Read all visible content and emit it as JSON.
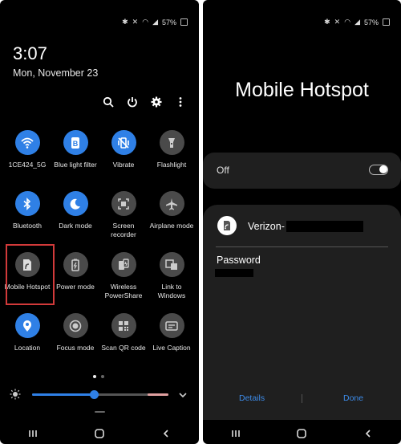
{
  "left": {
    "status": {
      "battery": "57%"
    },
    "clock": "3:07",
    "date": "Mon, November 23",
    "top_icons": [
      "search-icon",
      "power-icon",
      "settings-icon",
      "more-icon"
    ],
    "tiles": [
      [
        {
          "label": "1CE424_5G",
          "icon": "wifi-icon",
          "on": true
        },
        {
          "label": "Blue light filter",
          "icon": "blue-light-icon",
          "on": true
        },
        {
          "label": "Vibrate",
          "icon": "vibrate-icon",
          "on": true
        },
        {
          "label": "Flashlight",
          "icon": "flashlight-icon",
          "on": false
        }
      ],
      [
        {
          "label": "Bluetooth",
          "icon": "bluetooth-icon",
          "on": true
        },
        {
          "label": "Dark mode",
          "icon": "moon-icon",
          "on": true
        },
        {
          "label": "Screen recorder",
          "icon": "screen-recorder-icon",
          "on": false
        },
        {
          "label": "Airplane mode",
          "icon": "airplane-icon",
          "on": false
        }
      ],
      [
        {
          "label": "Mobile Hotspot",
          "icon": "hotspot-icon",
          "on": false
        },
        {
          "label": "Power mode",
          "icon": "power-mode-icon",
          "on": false
        },
        {
          "label": "Wireless PowerShare",
          "icon": "powershare-icon",
          "on": false
        },
        {
          "label": "Link to Windows",
          "icon": "link-windows-icon",
          "on": false
        }
      ],
      [
        {
          "label": "Location",
          "icon": "location-icon",
          "on": true
        },
        {
          "label": "Focus mode",
          "icon": "focus-icon",
          "on": false
        },
        {
          "label": "Scan QR code",
          "icon": "qr-icon",
          "on": false
        },
        {
          "label": "Live Caption",
          "icon": "caption-icon",
          "on": false
        }
      ]
    ],
    "brightness_fraction": 0.45,
    "colors": {
      "accent": "#2f80e6",
      "highlight": "#d23a3a"
    }
  },
  "right": {
    "status": {
      "battery": "57%"
    },
    "title": "Mobile Hotspot",
    "toggle_label": "Off",
    "toggle_on": false,
    "network_prefix": "Verizon-",
    "password_label": "Password",
    "details_button": "Details",
    "done_button": "Done"
  }
}
